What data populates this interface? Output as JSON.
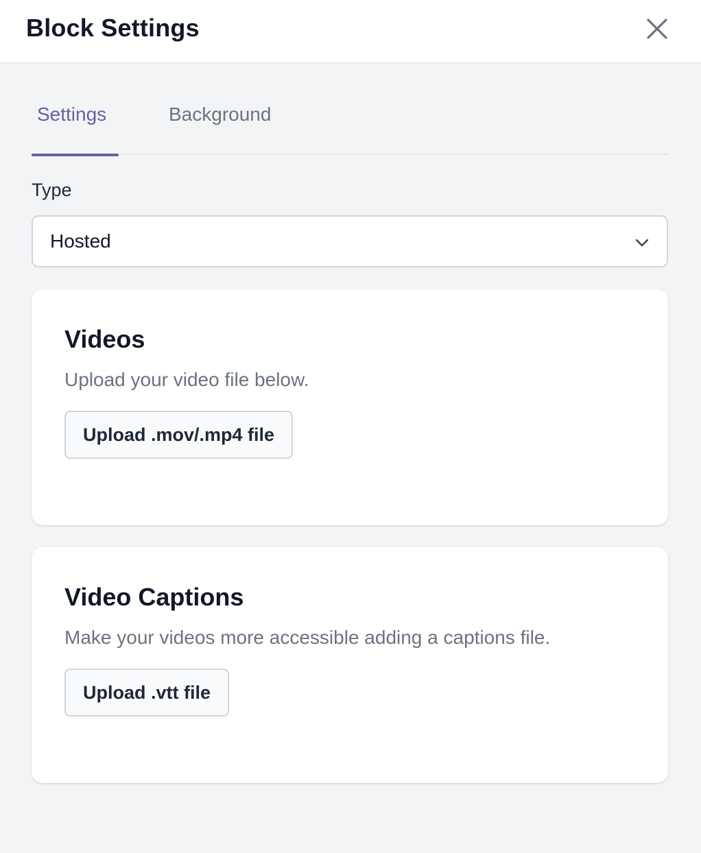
{
  "header": {
    "title": "Block Settings",
    "close_icon": "close-icon"
  },
  "tabs": [
    {
      "label": "Settings",
      "active": true
    },
    {
      "label": "Background",
      "active": false
    }
  ],
  "type_field": {
    "label": "Type",
    "value": "Hosted",
    "icon": "chevron-down-icon"
  },
  "videos_card": {
    "title": "Videos",
    "description": "Upload your video file below.",
    "button_label": "Upload .mov/.mp4 file"
  },
  "captions_card": {
    "title": "Video Captions",
    "description": "Make your videos more accessible adding a captions file.",
    "button_label": "Upload .vtt file"
  },
  "colors": {
    "accent": "#6462a6",
    "background": "#f3f4f6",
    "card": "#ffffff",
    "muted_text": "#6b7280"
  }
}
